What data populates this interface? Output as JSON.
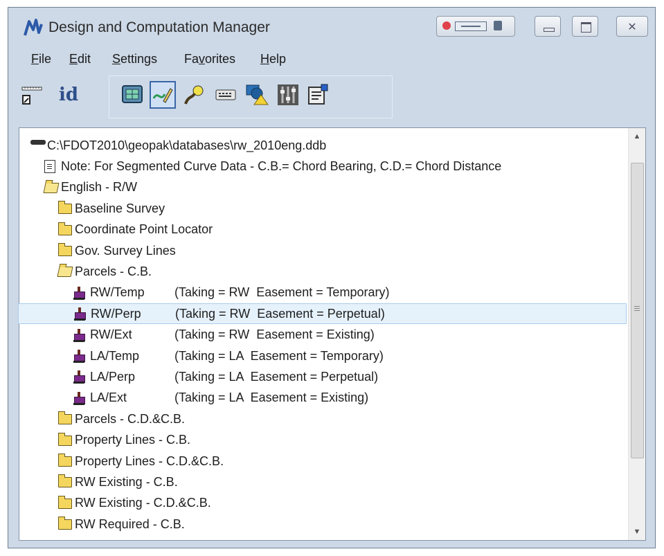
{
  "window": {
    "title": "Design and Computation Manager"
  },
  "menubar": [
    {
      "pre": "",
      "u": "F",
      "post": "ile"
    },
    {
      "pre": "",
      "u": "E",
      "post": "dit"
    },
    {
      "pre": "",
      "u": "S",
      "post": "ettings"
    },
    {
      "pre": "Fa",
      "u": "v",
      "post": "orites"
    },
    {
      "pre": "",
      "u": "H",
      "post": "elp"
    }
  ],
  "toolbar": {
    "id_label": "id",
    "tools": [
      "ruler-icon",
      "id-icon",
      "monitor-icon",
      "draw-icon",
      "probe-icon",
      "keyboard-icon",
      "shape-icon",
      "sliders-icon",
      "clipboard-icon"
    ],
    "selected": "draw-icon"
  },
  "tree": [
    {
      "icon": "database-icon",
      "name": "C:\\FDOT2010\\geopak\\databases\\rw_2010eng.ddb",
      "desc": "",
      "indent": 0
    },
    {
      "icon": "note-icon",
      "name": "Note: For Segmented Curve Data - C.B.= Chord Bearing, C.D.= Chord Distance",
      "desc": "",
      "indent": 1
    },
    {
      "icon": "folder-open-icon",
      "name": "English - R/W",
      "desc": "",
      "indent": 1
    },
    {
      "icon": "folder-icon",
      "name": "Baseline Survey",
      "desc": "",
      "indent": 2
    },
    {
      "icon": "folder-icon",
      "name": "Coordinate Point Locator",
      "desc": "",
      "indent": 2
    },
    {
      "icon": "folder-icon",
      "name": "Gov. Survey Lines",
      "desc": "",
      "indent": 2
    },
    {
      "icon": "folder-open-icon",
      "name": "Parcels - C.B.",
      "desc": "",
      "indent": 2
    },
    {
      "icon": "item-icon",
      "name": "RW/Temp",
      "desc": "(Taking = RW  Easement = Temporary)",
      "indent": 3
    },
    {
      "icon": "item-icon",
      "name": "RW/Perp",
      "desc": "(Taking = RW  Easement = Perpetual)",
      "indent": 3,
      "selected": true
    },
    {
      "icon": "item-icon",
      "name": "RW/Ext",
      "desc": "(Taking = RW  Easement = Existing)",
      "indent": 3
    },
    {
      "icon": "item-icon",
      "name": "LA/Temp",
      "desc": "(Taking = LA  Easement = Temporary)",
      "indent": 3
    },
    {
      "icon": "item-icon",
      "name": "LA/Perp",
      "desc": "(Taking = LA  Easement = Perpetual)",
      "indent": 3
    },
    {
      "icon": "item-icon",
      "name": "LA/Ext",
      "desc": "(Taking = LA  Easement = Existing)",
      "indent": 3
    },
    {
      "icon": "folder-icon",
      "name": "Parcels - C.D.&C.B.",
      "desc": "",
      "indent": 2
    },
    {
      "icon": "folder-icon",
      "name": "Property Lines - C.B.",
      "desc": "",
      "indent": 2
    },
    {
      "icon": "folder-icon",
      "name": "Property Lines - C.D.&C.B.",
      "desc": "",
      "indent": 2
    },
    {
      "icon": "folder-icon",
      "name": "RW Existing - C.B.",
      "desc": "",
      "indent": 2
    },
    {
      "icon": "folder-icon",
      "name": "RW Existing - C.D.&C.B.",
      "desc": "",
      "indent": 2
    },
    {
      "icon": "folder-icon",
      "name": "RW Required - C.B.",
      "desc": "",
      "indent": 2
    }
  ]
}
